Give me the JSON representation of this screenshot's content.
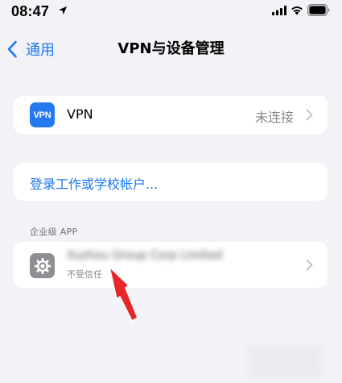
{
  "status_bar": {
    "time": "08:47",
    "icons": [
      "location-icon",
      "signal-icon",
      "wifi-icon",
      "battery-icon"
    ]
  },
  "nav": {
    "back_label": "通用",
    "title": "VPN与设备管理"
  },
  "vpn_row": {
    "badge_text": "VPN",
    "label": "VPN",
    "status": "未连接"
  },
  "login_row": {
    "label": "登录工作或学校帐户..."
  },
  "enterprise_section": {
    "header": "企业级 APP",
    "developer_name": "Xuzhou Group Corp Limited",
    "trust_status": "不受信任"
  },
  "colors": {
    "background": "#f2f2f7",
    "accent": "#1a78f2",
    "annotation_arrow": "#e8262a"
  }
}
